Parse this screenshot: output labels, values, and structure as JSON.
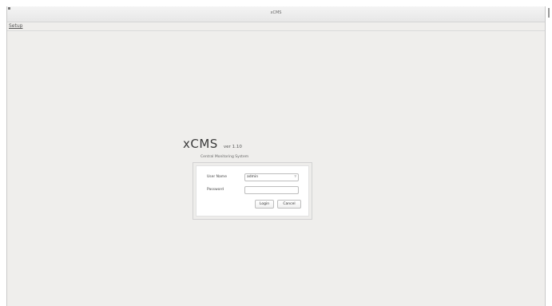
{
  "window": {
    "title": "xCMS"
  },
  "menubar": {
    "setup_label": "Setup"
  },
  "logo": {
    "name": "xCMS",
    "version": "ver 1.10",
    "subtitle": "Central Monitoring System"
  },
  "login": {
    "user_label": "User Name",
    "user_value": "admin",
    "password_label": "Password",
    "password_value": "",
    "login_button": "Login",
    "cancel_button": "Cancel"
  }
}
